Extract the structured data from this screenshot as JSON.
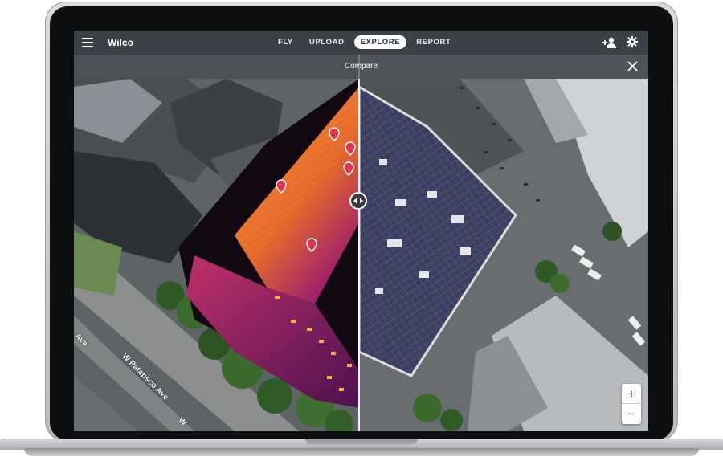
{
  "app": {
    "name": "Wilco"
  },
  "nav": {
    "tabs": [
      {
        "label": "FLY",
        "active": false
      },
      {
        "label": "UPLOAD",
        "active": false
      },
      {
        "label": "EXPLORE",
        "active": true
      },
      {
        "label": "REPORT",
        "active": false
      }
    ]
  },
  "compare": {
    "title": "Compare"
  },
  "map": {
    "street_labels": [
      "W Patapsco Ave",
      "Ave",
      "W"
    ],
    "zoom_in_label": "+",
    "zoom_out_label": "−"
  },
  "icons": {
    "menu": "menu-icon",
    "add_user": "add-user-icon",
    "settings": "gear-icon",
    "close": "close-icon",
    "compare_handle": "compare-arrows-icon",
    "markers": "map-pin-icon"
  },
  "colors": {
    "topbar": "#3b4146",
    "active_tab_bg": "#ffffff",
    "thermal_hot": "#f08a2c",
    "thermal_cool": "#2a0f3d",
    "marker": "#e8314a"
  }
}
